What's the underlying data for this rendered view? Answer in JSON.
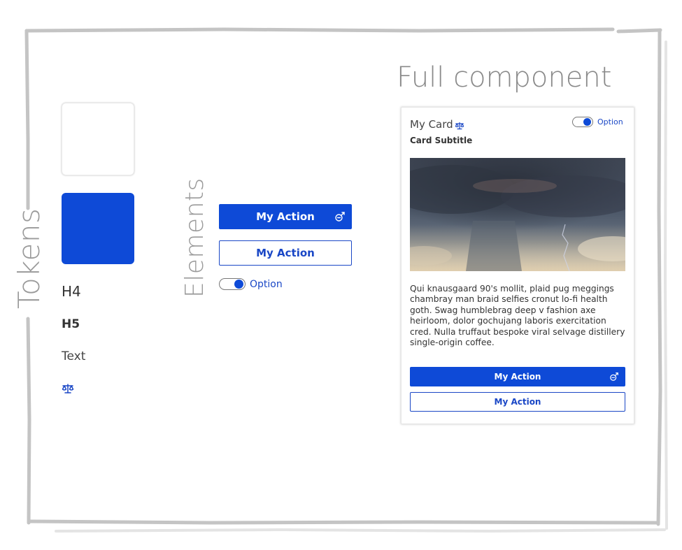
{
  "labels": {
    "tokens": "Tokens",
    "elements": "Elements",
    "full_component": "Full component"
  },
  "tokens": {
    "swatch_white": "#ffffff",
    "swatch_blue": "#0e4ad7",
    "h4": "H4",
    "h5": "H5",
    "text": "Text",
    "icon": "scale-icon"
  },
  "elements": {
    "primary_button": {
      "label": "My Action",
      "icon": "thumb-icon"
    },
    "secondary_button": {
      "label": "My Action"
    },
    "toggle": {
      "label": "Option",
      "checked": true
    }
  },
  "card": {
    "title": "My Card",
    "title_icon": "scale-icon",
    "toggle": {
      "label": "Option",
      "checked": true
    },
    "subtitle": "Card Subtitle",
    "image": "storm-clouds-image",
    "body": "Qui knausgaard 90's mollit, plaid pug meggings chambray man braid selfies cronut lo-fi health goth. Swag humblebrag deep v fashion axe heirloom, dolor gochujang laboris exercitation cred. Nulla truffaut bespoke viral selvage distillery single-origin coffee.",
    "primary_button": {
      "label": "My Action",
      "icon": "thumb-icon"
    },
    "secondary_button": {
      "label": "My Action"
    }
  },
  "colors": {
    "accent": "#0e4ad7",
    "accent_text": "#1a47c6",
    "frame": "#bdbdbd",
    "label_gray": "#9a9a9a"
  }
}
